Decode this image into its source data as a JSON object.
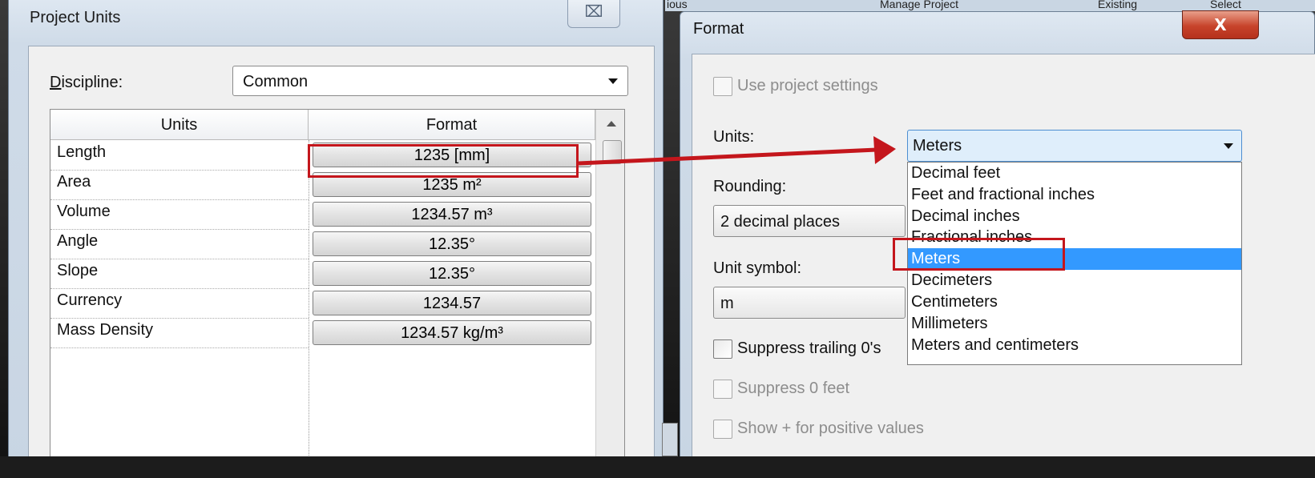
{
  "background": {
    "strip_texts": [
      "ious",
      "Manage Project",
      "Existing",
      "Select"
    ]
  },
  "project_units": {
    "title": "Project Units",
    "close_glyph": "⌧",
    "discipline_label_accel": "D",
    "discipline_label_rest": "iscipline:",
    "discipline_value": "Common",
    "columns": [
      "Units",
      "Format"
    ],
    "rows": [
      {
        "unit": "Length",
        "format": "1235 [mm]"
      },
      {
        "unit": "Area",
        "format": "1235 m²"
      },
      {
        "unit": "Volume",
        "format": "1234.57 m³"
      },
      {
        "unit": "Angle",
        "format": "12.35°"
      },
      {
        "unit": "Slope",
        "format": "12.35°"
      },
      {
        "unit": "Currency",
        "format": "1234.57"
      },
      {
        "unit": "Mass Density",
        "format": "1234.57 kg/m³"
      }
    ]
  },
  "format_dialog": {
    "title": "Format",
    "close_glyph": "X",
    "use_project_settings": "Use project settings",
    "units_label": "Units:",
    "units_value": "Meters",
    "rounding_label": "Rounding:",
    "rounding_value": "2 decimal places",
    "unit_symbol_label": "Unit symbol:",
    "unit_symbol_value": "m",
    "suppress_trailing": "Suppress trailing 0's",
    "suppress_feet": "Suppress 0 feet",
    "show_plus": "Show + for positive values",
    "unit_options": [
      "Decimal feet",
      "Feet and fractional inches",
      "Decimal inches",
      "Fractional inches",
      "Meters",
      "Decimeters",
      "Centimeters",
      "Millimeters",
      "Meters and centimeters"
    ],
    "selected_option": "Meters"
  },
  "colors": {
    "highlight_red": "#c4161c",
    "selection_blue": "#3399ff"
  }
}
